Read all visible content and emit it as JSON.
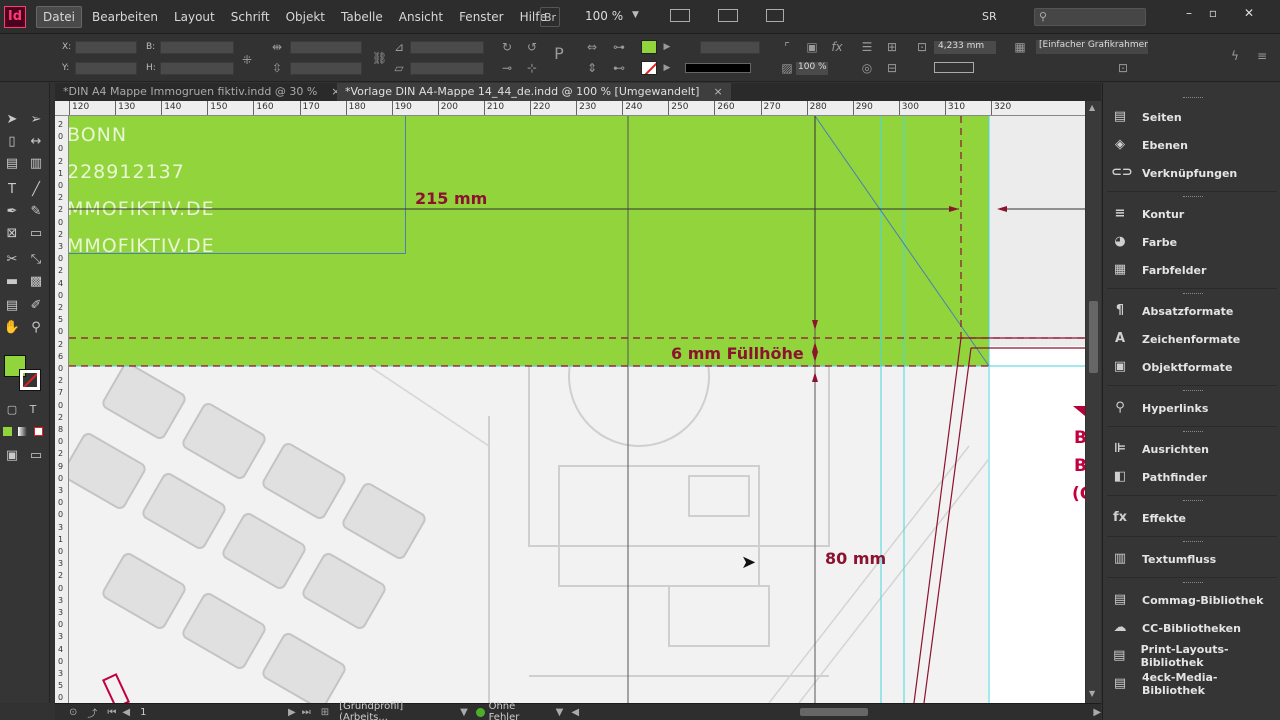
{
  "app": {
    "logo": "Id",
    "zoom": "100 %",
    "workspace": "SR",
    "bridge": "Br"
  },
  "menu": [
    "Datei",
    "Bearbeiten",
    "Layout",
    "Schrift",
    "Objekt",
    "Tabelle",
    "Ansicht",
    "Fenster",
    "Hilfe"
  ],
  "control": {
    "x_label": "X:",
    "y_label": "Y:",
    "b_label": "B:",
    "h_label": "H:",
    "stroke_value": "4,233 mm",
    "object_style": "[Einfacher Grafikrahmen]+",
    "percent": "100 %"
  },
  "tabs": [
    {
      "label": "*DIN A4 Mappe Immogruen fiktiv.indd @ 30 %",
      "close": "×",
      "active": false
    },
    {
      "label": "*Vorlage DIN A4-Mappe 14_44_de.indd @ 100 % [Umgewandelt]",
      "close": "×",
      "active": true
    }
  ],
  "ruler": {
    "ticks": [
      "120",
      "130",
      "140",
      "150",
      "160",
      "170",
      "180",
      "190",
      "200",
      "210",
      "220",
      "230",
      "240",
      "250",
      "260",
      "270",
      "280",
      "290",
      "300",
      "310",
      "320"
    ],
    "vticks": [
      "2",
      "0",
      "0",
      "2",
      "1",
      "0",
      "2",
      "2",
      "0",
      "2",
      "3",
      "0",
      "2",
      "4",
      "0",
      "2",
      "5",
      "0",
      "2",
      "6",
      "0",
      "2",
      "7",
      "0",
      "2",
      "8",
      "0",
      "2",
      "9",
      "0",
      "3",
      "0",
      "0",
      "3",
      "1",
      "0",
      "3",
      "2",
      "0",
      "3",
      "3",
      "0",
      "3",
      "4",
      "0",
      "3",
      "5",
      "0"
    ]
  },
  "canvas": {
    "text_lines": [
      "BONN",
      "228912137",
      "MMOFIKTIV.DE",
      "MMOFIKTIV.DE"
    ],
    "dim_215": "215 mm",
    "dim_fill": "6 mm Füllhöhe",
    "dim_80": "80 mm",
    "right_fragment": [
      "B",
      "B",
      "(C"
    ],
    "colors": {
      "green": "#92d43c",
      "dimension": "#8b1330",
      "guide": "#47d6e0"
    }
  },
  "status": {
    "page": "1",
    "profile": "[Grundprofil] (Arbeits...",
    "errors": "Ohne Fehler"
  },
  "panels": [
    {
      "label": "Seiten",
      "icon": "pages-icon",
      "glyph": "▤"
    },
    {
      "label": "Ebenen",
      "icon": "layers-icon",
      "glyph": "◈"
    },
    {
      "label": "Verknüpfungen",
      "icon": "links-icon",
      "glyph": "⊂⊃"
    },
    {
      "label": "Kontur",
      "icon": "stroke-icon",
      "glyph": "≡"
    },
    {
      "label": "Farbe",
      "icon": "color-icon",
      "glyph": "◕"
    },
    {
      "label": "Farbfelder",
      "icon": "swatches-icon",
      "glyph": "▦"
    },
    {
      "label": "Absatzformate",
      "icon": "paragraph-styles-icon",
      "glyph": "¶"
    },
    {
      "label": "Zeichenformate",
      "icon": "character-styles-icon",
      "glyph": "A"
    },
    {
      "label": "Objektformate",
      "icon": "object-styles-icon",
      "glyph": "▣"
    },
    {
      "label": "Hyperlinks",
      "icon": "hyperlinks-icon",
      "glyph": "⚲"
    },
    {
      "label": "Ausrichten",
      "icon": "align-icon",
      "glyph": "⊫"
    },
    {
      "label": "Pathfinder",
      "icon": "pathfinder-icon",
      "glyph": "◧"
    },
    {
      "label": "Effekte",
      "icon": "effects-icon",
      "glyph": "fx"
    },
    {
      "label": "Textumfluss",
      "icon": "text-wrap-icon",
      "glyph": "▥"
    },
    {
      "label": "Commag-Bibliothek",
      "icon": "library-icon",
      "glyph": "▤"
    },
    {
      "label": "CC-Bibliotheken",
      "icon": "cc-libraries-icon",
      "glyph": "☁"
    },
    {
      "label": "Print-Layouts-Bibliothek",
      "icon": "library-icon",
      "glyph": "▤"
    },
    {
      "label": "4eck-Media-Bibliothek",
      "icon": "library-icon",
      "glyph": "▤"
    }
  ]
}
